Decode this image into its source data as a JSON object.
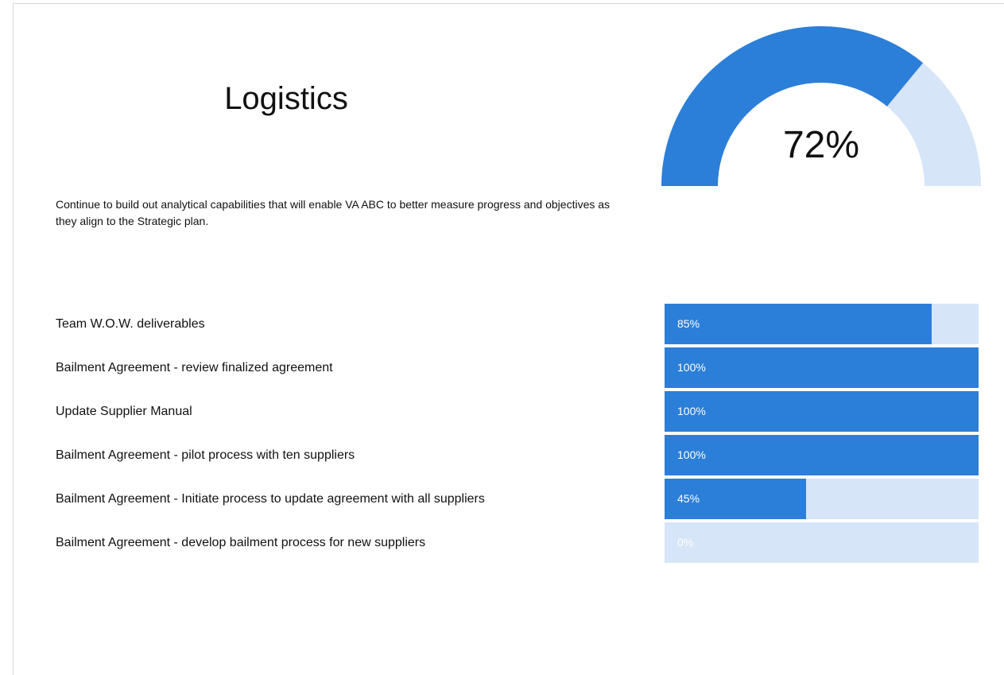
{
  "title": "Logistics",
  "description": "Continue to build out analytical capabilities that will enable VA ABC to better measure progress and objectives as they align to the Strategic plan.",
  "colors": {
    "fill": "#2b7fd8",
    "track": "#d6e5f7"
  },
  "gauge": {
    "value": 0.72,
    "label": "72%"
  },
  "chart_data": {
    "type": "bar",
    "categories": [
      "Team W.O.W. deliverables",
      "Bailment Agreement - review finalized agreement",
      "Update Supplier Manual",
      "Bailment Agreement - pilot process with ten suppliers",
      "Bailment Agreement - Initiate process to update agreement with all suppliers",
      "Bailment Agreement - develop bailment process for new suppliers"
    ],
    "values": [
      85,
      100,
      100,
      100,
      45,
      0
    ],
    "value_labels": [
      "85%",
      "100%",
      "100%",
      "100%",
      "45%",
      "0%"
    ],
    "xlim": [
      0,
      100
    ]
  }
}
